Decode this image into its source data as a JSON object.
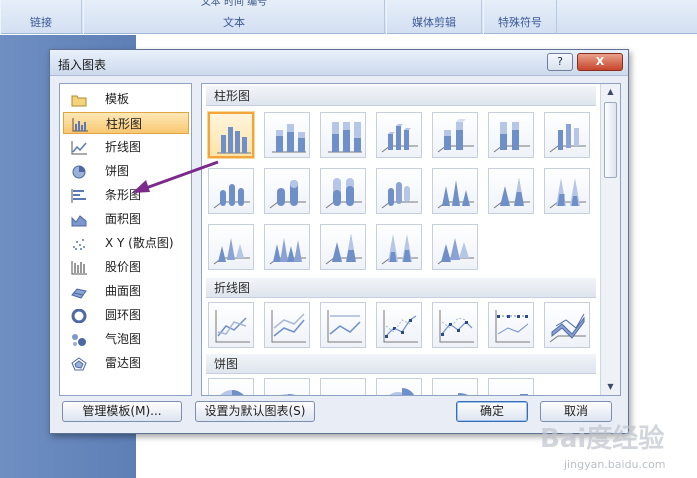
{
  "ribbon": {
    "groups": [
      {
        "label": "链接",
        "cut": ""
      },
      {
        "label": "文本",
        "cut": "文本          时间   编号"
      },
      {
        "label": "媒体剪辑",
        "cut": ""
      },
      {
        "label": "特殊符号",
        "cut": ""
      }
    ]
  },
  "dialog": {
    "title": "插入图表",
    "help_label": "?",
    "close_label": "X",
    "categories": [
      {
        "label": "模板",
        "icon": "folder-icon"
      },
      {
        "label": "柱形图",
        "icon": "column-chart-icon",
        "selected": true
      },
      {
        "label": "折线图",
        "icon": "line-chart-icon"
      },
      {
        "label": "饼图",
        "icon": "pie-chart-icon"
      },
      {
        "label": "条形图",
        "icon": "bar-chart-icon"
      },
      {
        "label": "面积图",
        "icon": "area-chart-icon"
      },
      {
        "label": "X Y (散点图)",
        "icon": "scatter-chart-icon"
      },
      {
        "label": "股价图",
        "icon": "stock-chart-icon"
      },
      {
        "label": "曲面图",
        "icon": "surface-chart-icon"
      },
      {
        "label": "圆环图",
        "icon": "doughnut-chart-icon"
      },
      {
        "label": "气泡图",
        "icon": "bubble-chart-icon"
      },
      {
        "label": "雷达图",
        "icon": "radar-chart-icon"
      }
    ],
    "sections": [
      {
        "label": "柱形图"
      },
      {
        "label": "折线图"
      },
      {
        "label": "饼图"
      }
    ],
    "buttons": {
      "manage_templates": "管理模板(M)...",
      "set_default": "设置为默认图表(S)",
      "ok": "确定",
      "cancel": "取消"
    }
  },
  "watermark": {
    "brand": "Bai度经验",
    "url": "jingyan.baidu.com"
  },
  "colors": {
    "accent": "#f1a53c",
    "arrow": "#7b2a8c",
    "chart_blue": "#6f8fc9"
  }
}
